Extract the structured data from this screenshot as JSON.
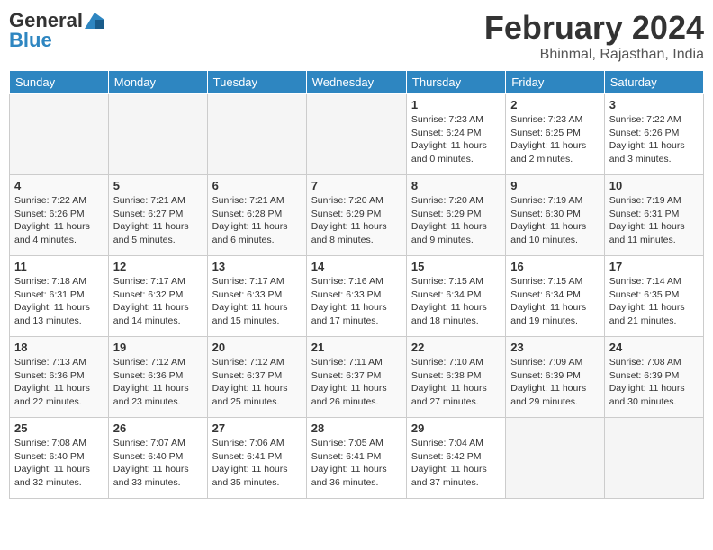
{
  "header": {
    "logo_line1": "General",
    "logo_line2": "Blue",
    "month_year": "February 2024",
    "location": "Bhinmal, Rajasthan, India"
  },
  "days_of_week": [
    "Sunday",
    "Monday",
    "Tuesday",
    "Wednesday",
    "Thursday",
    "Friday",
    "Saturday"
  ],
  "weeks": [
    [
      {
        "day": "",
        "info": ""
      },
      {
        "day": "",
        "info": ""
      },
      {
        "day": "",
        "info": ""
      },
      {
        "day": "",
        "info": ""
      },
      {
        "day": "1",
        "info": "Sunrise: 7:23 AM\nSunset: 6:24 PM\nDaylight: 11 hours and 0 minutes."
      },
      {
        "day": "2",
        "info": "Sunrise: 7:23 AM\nSunset: 6:25 PM\nDaylight: 11 hours and 2 minutes."
      },
      {
        "day": "3",
        "info": "Sunrise: 7:22 AM\nSunset: 6:26 PM\nDaylight: 11 hours and 3 minutes."
      }
    ],
    [
      {
        "day": "4",
        "info": "Sunrise: 7:22 AM\nSunset: 6:26 PM\nDaylight: 11 hours and 4 minutes."
      },
      {
        "day": "5",
        "info": "Sunrise: 7:21 AM\nSunset: 6:27 PM\nDaylight: 11 hours and 5 minutes."
      },
      {
        "day": "6",
        "info": "Sunrise: 7:21 AM\nSunset: 6:28 PM\nDaylight: 11 hours and 6 minutes."
      },
      {
        "day": "7",
        "info": "Sunrise: 7:20 AM\nSunset: 6:29 PM\nDaylight: 11 hours and 8 minutes."
      },
      {
        "day": "8",
        "info": "Sunrise: 7:20 AM\nSunset: 6:29 PM\nDaylight: 11 hours and 9 minutes."
      },
      {
        "day": "9",
        "info": "Sunrise: 7:19 AM\nSunset: 6:30 PM\nDaylight: 11 hours and 10 minutes."
      },
      {
        "day": "10",
        "info": "Sunrise: 7:19 AM\nSunset: 6:31 PM\nDaylight: 11 hours and 11 minutes."
      }
    ],
    [
      {
        "day": "11",
        "info": "Sunrise: 7:18 AM\nSunset: 6:31 PM\nDaylight: 11 hours and 13 minutes."
      },
      {
        "day": "12",
        "info": "Sunrise: 7:17 AM\nSunset: 6:32 PM\nDaylight: 11 hours and 14 minutes."
      },
      {
        "day": "13",
        "info": "Sunrise: 7:17 AM\nSunset: 6:33 PM\nDaylight: 11 hours and 15 minutes."
      },
      {
        "day": "14",
        "info": "Sunrise: 7:16 AM\nSunset: 6:33 PM\nDaylight: 11 hours and 17 minutes."
      },
      {
        "day": "15",
        "info": "Sunrise: 7:15 AM\nSunset: 6:34 PM\nDaylight: 11 hours and 18 minutes."
      },
      {
        "day": "16",
        "info": "Sunrise: 7:15 AM\nSunset: 6:34 PM\nDaylight: 11 hours and 19 minutes."
      },
      {
        "day": "17",
        "info": "Sunrise: 7:14 AM\nSunset: 6:35 PM\nDaylight: 11 hours and 21 minutes."
      }
    ],
    [
      {
        "day": "18",
        "info": "Sunrise: 7:13 AM\nSunset: 6:36 PM\nDaylight: 11 hours and 22 minutes."
      },
      {
        "day": "19",
        "info": "Sunrise: 7:12 AM\nSunset: 6:36 PM\nDaylight: 11 hours and 23 minutes."
      },
      {
        "day": "20",
        "info": "Sunrise: 7:12 AM\nSunset: 6:37 PM\nDaylight: 11 hours and 25 minutes."
      },
      {
        "day": "21",
        "info": "Sunrise: 7:11 AM\nSunset: 6:37 PM\nDaylight: 11 hours and 26 minutes."
      },
      {
        "day": "22",
        "info": "Sunrise: 7:10 AM\nSunset: 6:38 PM\nDaylight: 11 hours and 27 minutes."
      },
      {
        "day": "23",
        "info": "Sunrise: 7:09 AM\nSunset: 6:39 PM\nDaylight: 11 hours and 29 minutes."
      },
      {
        "day": "24",
        "info": "Sunrise: 7:08 AM\nSunset: 6:39 PM\nDaylight: 11 hours and 30 minutes."
      }
    ],
    [
      {
        "day": "25",
        "info": "Sunrise: 7:08 AM\nSunset: 6:40 PM\nDaylight: 11 hours and 32 minutes."
      },
      {
        "day": "26",
        "info": "Sunrise: 7:07 AM\nSunset: 6:40 PM\nDaylight: 11 hours and 33 minutes."
      },
      {
        "day": "27",
        "info": "Sunrise: 7:06 AM\nSunset: 6:41 PM\nDaylight: 11 hours and 35 minutes."
      },
      {
        "day": "28",
        "info": "Sunrise: 7:05 AM\nSunset: 6:41 PM\nDaylight: 11 hours and 36 minutes."
      },
      {
        "day": "29",
        "info": "Sunrise: 7:04 AM\nSunset: 6:42 PM\nDaylight: 11 hours and 37 minutes."
      },
      {
        "day": "",
        "info": ""
      },
      {
        "day": "",
        "info": ""
      }
    ]
  ]
}
